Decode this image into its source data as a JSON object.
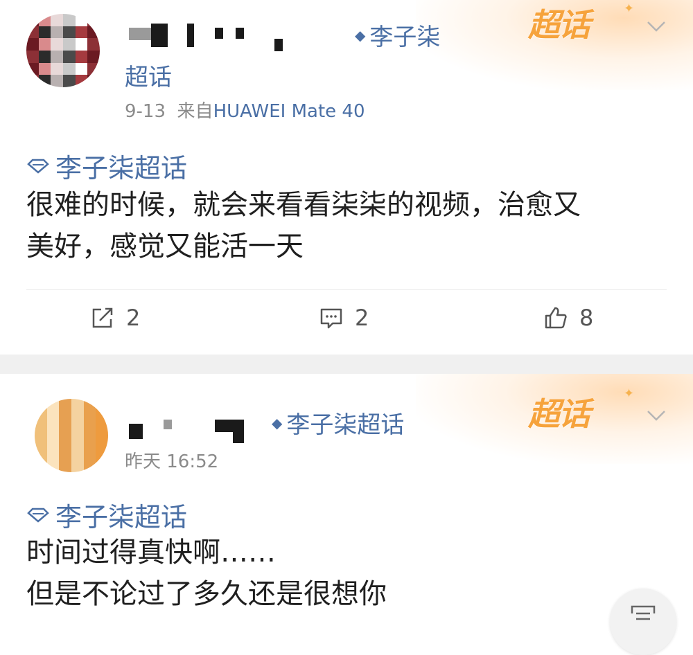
{
  "posts": [
    {
      "badge": "超话",
      "topic_name": "李子柒",
      "topic_name_wrap": "超话",
      "date": "9-13",
      "source_prefix": "来自",
      "device": "HUAWEI Mate 40",
      "topic_tag": "李子柒超话",
      "content_lines": [
        "很难的时候，就会来看看柒柒的视频，治愈又",
        "美好，感觉又能活一天"
      ],
      "actions": {
        "share_count": "2",
        "comment_count": "2",
        "like_count": "8"
      }
    },
    {
      "badge": "超话",
      "topic_name": "李子柒超话",
      "date": "昨天 16:52",
      "topic_tag": "李子柒超话",
      "content_lines": [
        "时间过得真快啊……",
        "但是不论过了多久还是很想你"
      ]
    }
  ],
  "colors": {
    "link_blue": "#4a6fa5",
    "badge_orange": "#f6a33c",
    "meta_gray": "#8a8a8a",
    "text": "#1f1f1f"
  },
  "icons": [
    "tag-icon",
    "topic-gem-icon",
    "chevron-down-icon",
    "share-icon",
    "comment-icon",
    "like-icon",
    "compose-icon"
  ]
}
